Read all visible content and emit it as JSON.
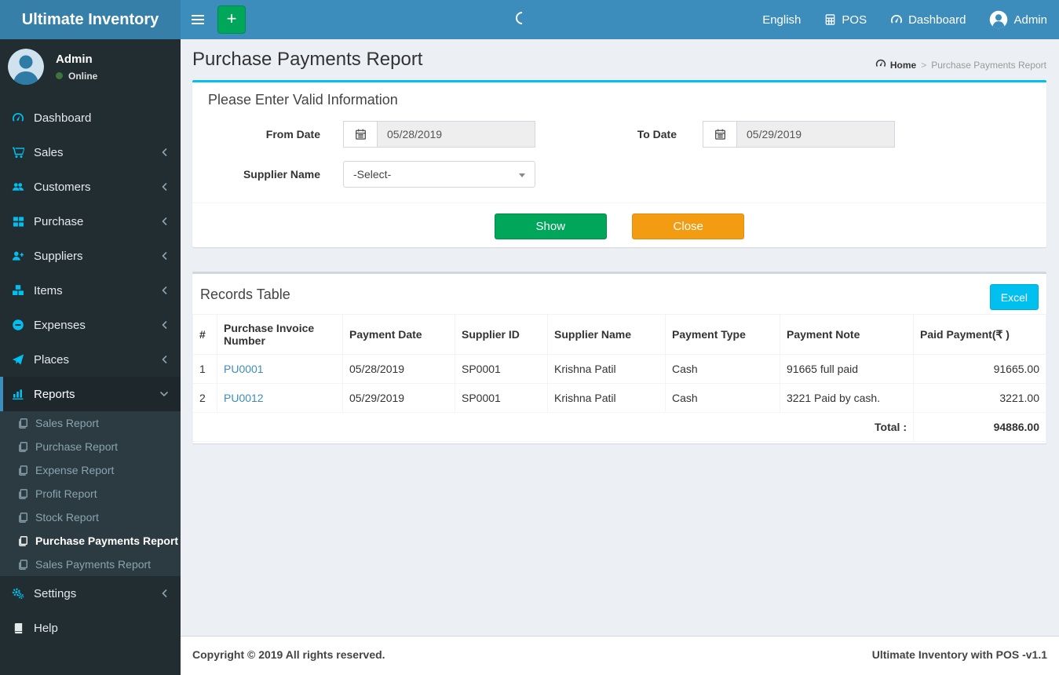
{
  "topbar": {
    "brand": "Ultimate Inventory",
    "language": "English",
    "pos_label": "POS",
    "dashboard_label": "Dashboard",
    "user_label": "Admin"
  },
  "sidebar": {
    "user": {
      "name": "Admin",
      "status": "Online"
    },
    "items": [
      {
        "label": "Dashboard"
      },
      {
        "label": "Sales"
      },
      {
        "label": "Customers"
      },
      {
        "label": "Purchase"
      },
      {
        "label": "Suppliers"
      },
      {
        "label": "Items"
      },
      {
        "label": "Expenses"
      },
      {
        "label": "Places"
      },
      {
        "label": "Reports"
      },
      {
        "label": "Settings"
      },
      {
        "label": "Help"
      }
    ],
    "reports_submenu": [
      {
        "label": "Sales Report"
      },
      {
        "label": "Purchase Report"
      },
      {
        "label": "Expense Report"
      },
      {
        "label": "Profit Report"
      },
      {
        "label": "Stock Report"
      },
      {
        "label": "Purchase Payments Report"
      },
      {
        "label": "Sales Payments Report"
      }
    ]
  },
  "page": {
    "title": "Purchase Payments Report",
    "breadcrumb_home": "Home",
    "breadcrumb_separator": ">",
    "breadcrumb_current": "Purchase Payments Report"
  },
  "filter": {
    "heading": "Please Enter Valid Information",
    "from_date_label": "From Date",
    "from_date_value": "05/28/2019",
    "to_date_label": "To Date",
    "to_date_value": "05/29/2019",
    "supplier_label": "Supplier Name",
    "supplier_value": "-Select-",
    "show_label": "Show",
    "close_label": "Close"
  },
  "records": {
    "heading": "Records Table",
    "excel_label": "Excel",
    "columns": [
      "#",
      "Purchase Invoice Number",
      "Payment Date",
      "Supplier ID",
      "Supplier Name",
      "Payment Type",
      "Payment Note",
      "Paid Payment(₹ )"
    ],
    "rows": [
      {
        "sn": "1",
        "invoice": "PU0001",
        "date": "05/28/2019",
        "supplier_id": "SP0001",
        "supplier_name": "Krishna Patil",
        "type": "Cash",
        "note": "91665 full paid",
        "amount": "91665.00"
      },
      {
        "sn": "2",
        "invoice": "PU0012",
        "date": "05/29/2019",
        "supplier_id": "SP0001",
        "supplier_name": "Krishna Patil",
        "type": "Cash",
        "note": "3221 Paid by cash.",
        "amount": "3221.00"
      }
    ],
    "total_label": "Total :",
    "total_value": "94886.00"
  },
  "footer": {
    "left": "Copyright © 2019 All rights reserved.",
    "right": "Ultimate Inventory with POS -v1.1"
  },
  "colors": {
    "navbar_blue": "#3c8dbc",
    "logo_blue": "#367fa9",
    "sidebar_dark": "#222d32",
    "icon_cyan": "#00c0ef",
    "success_green": "#00a65a",
    "warning_orange": "#f39c12",
    "info_cyan": "#00c0ef"
  }
}
